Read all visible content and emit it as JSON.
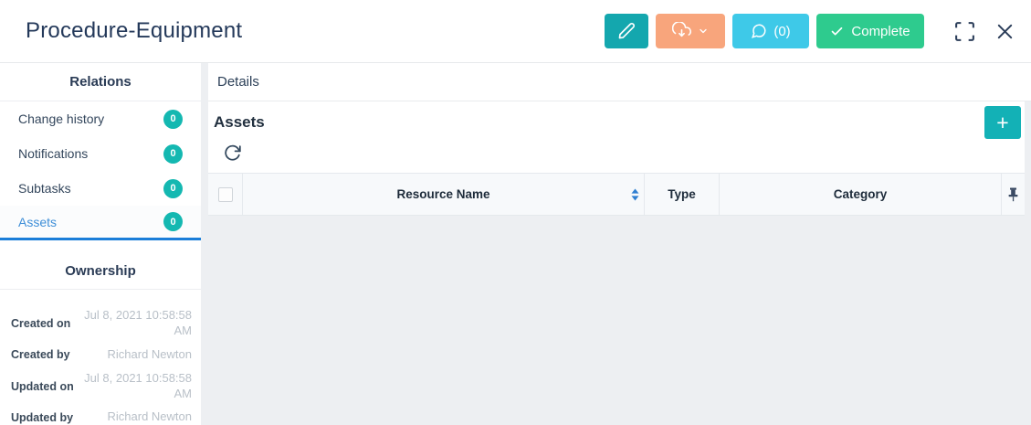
{
  "header": {
    "title": "Procedure-Equipment",
    "buttons": {
      "edit": {
        "icon": "pencil-icon"
      },
      "export": {
        "icon": "cloud-download-icon",
        "caret_icon": "chevron-down-icon"
      },
      "comments": {
        "icon": "chat-bubble-icon",
        "label": "(0)"
      },
      "complete": {
        "icon": "check-icon",
        "label": "Complete"
      },
      "fullscreen": {
        "icon": "fullscreen-icon"
      },
      "close": {
        "icon": "close-icon"
      }
    }
  },
  "sidebar": {
    "relations_heading": "Relations",
    "items": [
      {
        "label": "Change history",
        "count": "0",
        "active": false
      },
      {
        "label": "Notifications",
        "count": "0",
        "active": false
      },
      {
        "label": "Subtasks",
        "count": "0",
        "active": false
      },
      {
        "label": "Assets",
        "count": "0",
        "active": true
      }
    ],
    "ownership_heading": "Ownership",
    "ownership_fields": [
      {
        "label": "Created on",
        "value": "Jul 8, 2021 10:58:58 AM"
      },
      {
        "label": "Created by",
        "value": "Richard Newton"
      },
      {
        "label": "Updated on",
        "value": "Jul 8, 2021 10:58:58 AM"
      },
      {
        "label": "Updated by",
        "value": "Richard Newton"
      }
    ]
  },
  "main": {
    "tab_label": "Details",
    "section_title": "Assets",
    "add_button_label": "+",
    "refresh_icon": "refresh-icon",
    "table": {
      "columns": [
        "Resource Name",
        "Type",
        "Category"
      ],
      "sort_icon": "sort-arrows-icon",
      "pin_icon": "pin-icon",
      "rows": []
    }
  },
  "colors": {
    "title_navy": "#24395a",
    "teal_button": "#14a7ae",
    "salmon_button": "#f8a57c",
    "cyan_button": "#3ec9e8",
    "green_button": "#2ecb8e",
    "badge_teal": "#14b8b1",
    "add_button_teal": "#13b1b6",
    "active_link_blue": "#3f8fd8",
    "active_underline_blue": "#1b7ed9",
    "sort_arrow_blue": "#2f7fd1",
    "muted_value_gray": "#b9c0c8",
    "page_background": "#edeff2"
  }
}
